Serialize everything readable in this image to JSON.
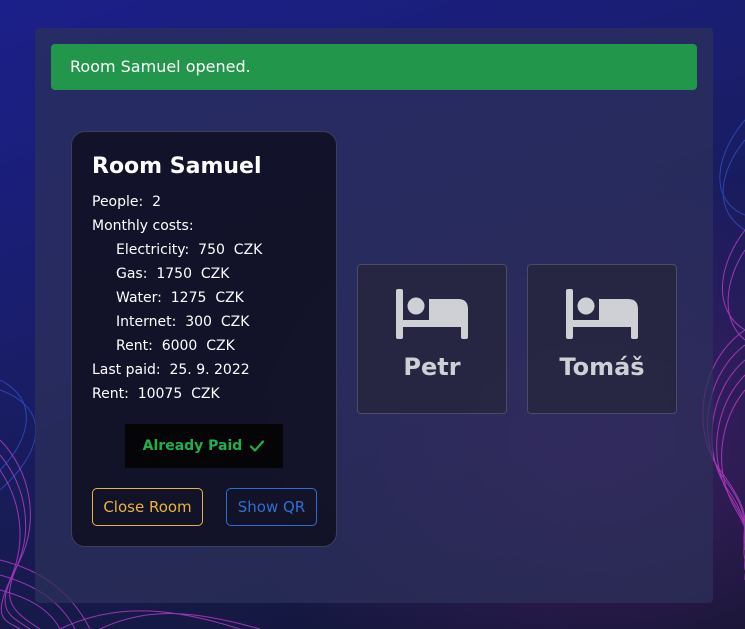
{
  "alert": {
    "message": "Room Samuel opened."
  },
  "room": {
    "title": "Room Samuel",
    "people_label": "People:",
    "people_value": "2",
    "monthly_costs_label": "Monthly costs:",
    "costs": [
      {
        "label": "Electricity:",
        "amount": "750",
        "currency": "CZK"
      },
      {
        "label": "Gas:",
        "amount": "1750",
        "currency": "CZK"
      },
      {
        "label": "Water:",
        "amount": "1275",
        "currency": "CZK"
      },
      {
        "label": "Internet:",
        "amount": "300",
        "currency": "CZK"
      },
      {
        "label": "Rent:",
        "amount": "6000",
        "currency": "CZK"
      }
    ],
    "last_paid_label": "Last paid:",
    "last_paid_value": "25. 9. 2022",
    "rent_label": "Rent:",
    "rent_amount": "10075",
    "rent_currency": "CZK",
    "paid_status": "Already Paid",
    "paid_icon": "check-icon",
    "close_button": "Close Room",
    "qr_button": "Show QR"
  },
  "people": [
    {
      "name": "Petr",
      "icon": "bed-icon"
    },
    {
      "name": "Tomáš",
      "icon": "bed-icon"
    }
  ],
  "colors": {
    "alert_bg": "#22964a",
    "paid_text": "#1fb14a",
    "close_button": "#e8b53a",
    "qr_button": "#2f6fd1"
  }
}
